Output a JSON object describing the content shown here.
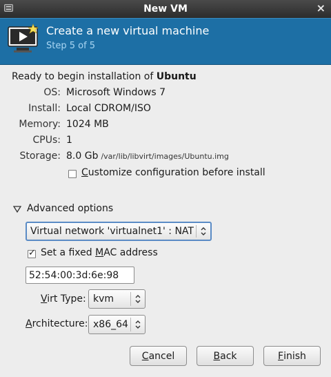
{
  "window": {
    "title": "New VM",
    "close_glyph": "×"
  },
  "banner": {
    "title": "Create a new virtual machine",
    "step": "Step 5 of 5",
    "icon": "monitor-play-icon"
  },
  "summary": {
    "ready_prefix": "Ready to begin installation of ",
    "os_name": "Ubuntu",
    "rows": [
      {
        "label": "OS:",
        "value": "Microsoft Windows 7"
      },
      {
        "label": "Install:",
        "value": "Local CDROM/ISO"
      },
      {
        "label": "Memory:",
        "value": "1024 MB"
      },
      {
        "label": "CPUs:",
        "value": "1"
      },
      {
        "label": "Storage:",
        "value": "8.0 Gb",
        "path": "/var/lib/libvirt/images/Ubuntu.img"
      }
    ],
    "customize": {
      "pre": "",
      "mnemonic": "C",
      "post": "ustomize configuration before install",
      "checked": false
    }
  },
  "advanced": {
    "label": "Advanced options",
    "network": "Virtual network 'virtualnet1' : NAT",
    "fixed_mac": {
      "pre": "Set a fixed ",
      "mnemonic": "M",
      "post": "AC address",
      "checked": true
    },
    "mac_value": "52:54:00:3d:6e:98",
    "virt_type": {
      "pre": "",
      "mnemonic": "V",
      "post": "irt Type:",
      "value": "kvm"
    },
    "architecture": {
      "pre": "",
      "mnemonic": "A",
      "post": "rchitecture:",
      "value": "x86_64"
    }
  },
  "buttons": {
    "cancel": {
      "pre": "",
      "mnemonic": "C",
      "post": "ancel"
    },
    "back": {
      "pre": "",
      "mnemonic": "B",
      "post": "ack"
    },
    "finish": {
      "pre": "",
      "mnemonic": "F",
      "post": "inish"
    }
  },
  "colors": {
    "banner": "#1d6fa5",
    "titlebar": "#2c2c2c",
    "focus": "#5a8bc5"
  }
}
